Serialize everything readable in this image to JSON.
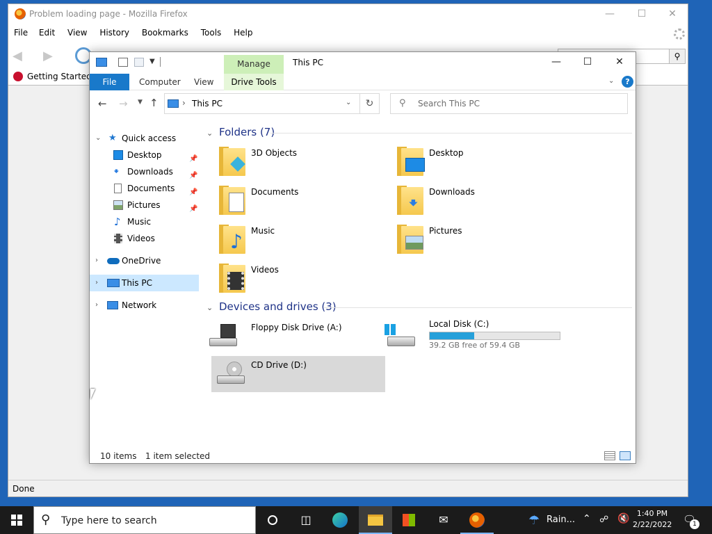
{
  "firefox": {
    "title": "Problem loading page - Mozilla Firefox",
    "menu": [
      "File",
      "Edit",
      "View",
      "History",
      "Bookmarks",
      "Tools",
      "Help"
    ],
    "bookmark": "Getting Started",
    "status": "Done"
  },
  "explorer": {
    "title": "This PC",
    "manage_tab": "Manage",
    "tabs": [
      "File",
      "Computer",
      "View",
      "Drive Tools"
    ],
    "address": "This PC",
    "search_placeholder": "Search This PC",
    "nav": {
      "quick_access": "Quick access",
      "qa_items": [
        "Desktop",
        "Downloads",
        "Documents",
        "Pictures",
        "Music",
        "Videos"
      ],
      "onedrive": "OneDrive",
      "this_pc": "This PC",
      "network": "Network"
    },
    "folders_header": "Folders (7)",
    "folders": [
      "3D Objects",
      "Desktop",
      "Documents",
      "Downloads",
      "Music",
      "Pictures",
      "Videos"
    ],
    "devices_header": "Devices and drives (3)",
    "drives": {
      "floppy": "Floppy Disk Drive (A:)",
      "local": "Local Disk (C:)",
      "local_free": "39.2 GB free of 59.4 GB",
      "local_used_fraction": 0.34,
      "cd": "CD Drive (D:)"
    },
    "status_items": "10 items",
    "status_selected": "1 item selected"
  },
  "taskbar": {
    "search_placeholder": "Type here to search",
    "weather": "Rain...",
    "time": "1:40 PM",
    "date": "2/22/2022",
    "notification_count": "1"
  }
}
